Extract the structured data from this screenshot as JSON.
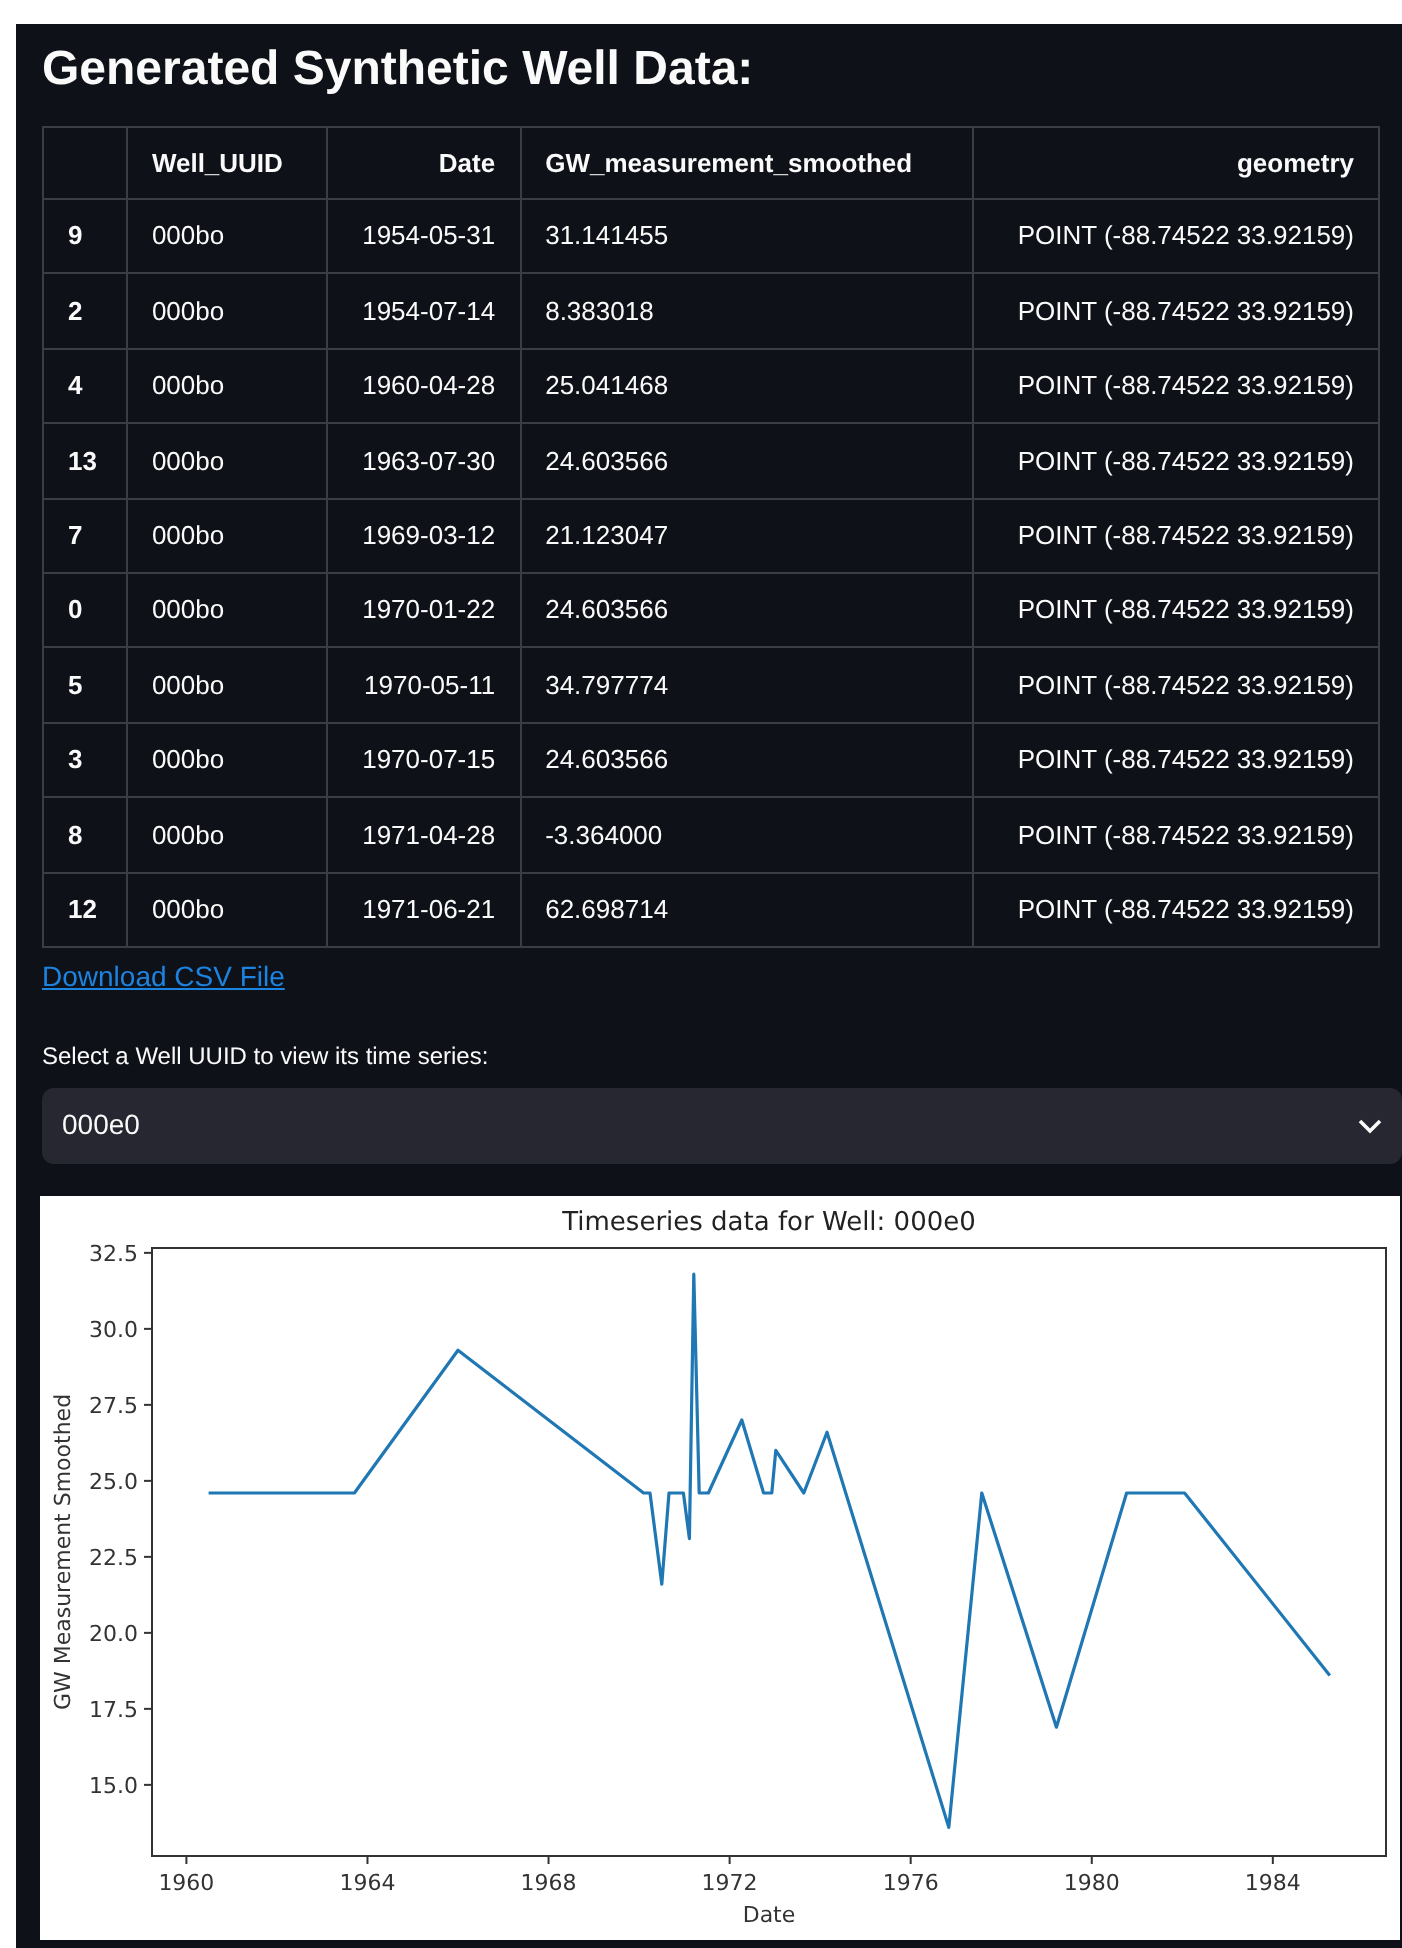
{
  "title": "Generated Synthetic Well Data:",
  "table": {
    "columns": [
      "",
      "Well_UUID",
      "Date",
      "GW_measurement_smoothed",
      "geometry"
    ],
    "rows": [
      [
        "9",
        "000bo",
        "1954-05-31",
        "31.141455",
        "POINT (-88.74522 33.92159)"
      ],
      [
        "2",
        "000bo",
        "1954-07-14",
        "8.383018",
        "POINT (-88.74522 33.92159)"
      ],
      [
        "4",
        "000bo",
        "1960-04-28",
        "25.041468",
        "POINT (-88.74522 33.92159)"
      ],
      [
        "13",
        "000bo",
        "1963-07-30",
        "24.603566",
        "POINT (-88.74522 33.92159)"
      ],
      [
        "7",
        "000bo",
        "1969-03-12",
        "21.123047",
        "POINT (-88.74522 33.92159)"
      ],
      [
        "0",
        "000bo",
        "1970-01-22",
        "24.603566",
        "POINT (-88.74522 33.92159)"
      ],
      [
        "5",
        "000bo",
        "1970-05-11",
        "34.797774",
        "POINT (-88.74522 33.92159)"
      ],
      [
        "3",
        "000bo",
        "1970-07-15",
        "24.603566",
        "POINT (-88.74522 33.92159)"
      ],
      [
        "8",
        "000bo",
        "1971-04-28",
        "-3.364000",
        "POINT (-88.74522 33.92159)"
      ],
      [
        "12",
        "000bo",
        "1971-06-21",
        "62.698714",
        "POINT (-88.74522 33.92159)"
      ]
    ]
  },
  "download_link": "Download CSV File",
  "select": {
    "label": "Select a Well UUID to view its time series:",
    "value": "000e0"
  },
  "chart_data": {
    "type": "line",
    "title": "Timeseries data for Well: 000e0",
    "xlabel": "Date",
    "ylabel": "GW Measurement Smoothed",
    "x": [
      1960.49,
      1963.71,
      1966.0,
      1970.1,
      1970.24,
      1970.5,
      1970.66,
      1970.98,
      1971.11,
      1971.21,
      1971.33,
      1971.53,
      1972.27,
      1972.75,
      1972.93,
      1973.02,
      1973.64,
      1974.15,
      1976.84,
      1977.57,
      1979.22,
      1980.77,
      1982.05,
      1985.26
    ],
    "series": [
      {
        "color": "#1f77b4",
        "values": [
          24.6,
          24.6,
          29.3,
          24.6,
          24.6,
          21.6,
          24.6,
          24.6,
          23.1,
          31.8,
          24.6,
          24.6,
          27.0,
          24.6,
          24.6,
          26.0,
          24.6,
          26.6,
          13.6,
          24.6,
          16.9,
          24.6,
          24.6,
          18.6
        ]
      }
    ],
    "xlim": [
      1959.24,
      1986.5
    ],
    "ylim": [
      12.66,
      32.66
    ],
    "xticks": [
      1960,
      1964,
      1968,
      1972,
      1976,
      1980,
      1984
    ],
    "yticks": [
      {
        "value": 15,
        "label": "15.0"
      },
      {
        "value": 17.5,
        "label": "17.5"
      },
      {
        "value": 20,
        "label": "20.0"
      },
      {
        "value": 22.5,
        "label": "22.5"
      },
      {
        "value": 25,
        "label": "25.0"
      },
      {
        "value": 27.5,
        "label": "27.5"
      },
      {
        "value": 30,
        "label": "30.0"
      },
      {
        "value": 32.5,
        "label": "32.5"
      }
    ]
  }
}
